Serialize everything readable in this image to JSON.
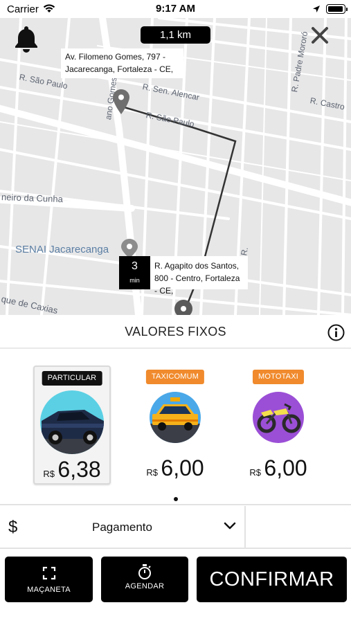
{
  "status_bar": {
    "carrier": "Carrier",
    "time": "9:17 AM"
  },
  "map": {
    "distance": "1,1 km",
    "origin_address": "Av. Filomeno Gomes, 797 - Jacarecanga, Fortaleza - CE,",
    "destination_address": "R. Agapito dos Santos, 800 - Centro, Fortaleza - CE,",
    "eta_value": "3",
    "eta_unit": "min",
    "poi": "SENAI Jacarecanga",
    "streets": {
      "sao_paulo_left": "R. São Paulo",
      "sao_paulo_route": "R. São Paulo",
      "sen_alencar": "R. Sen. Alencar",
      "padre_mororo": "R. Padre Mororó",
      "castro": "R. Castro",
      "gomes": "ano Gomes",
      "cunha": "neiro da Cunha",
      "caxias": "que de Caxias",
      "small_r": "R."
    }
  },
  "fixed_values": {
    "title": "VALORES FIXOS"
  },
  "options": [
    {
      "badge": "PARTICULAR",
      "badge_color": "#111111",
      "currency": "R$",
      "price": "6,38",
      "icon": "car-icon",
      "selected": true
    },
    {
      "badge": "TAXICOMUM",
      "badge_color": "#f08a2c",
      "currency": "R$",
      "price": "6,00",
      "icon": "taxi-icon",
      "selected": false
    },
    {
      "badge": "MOTOTAXI",
      "badge_color": "#f08a2c",
      "currency": "R$",
      "price": "6,00",
      "icon": "motorcycle-icon",
      "selected": false
    }
  ],
  "payment": {
    "icon_symbol": "$",
    "label": "Pagamento"
  },
  "buttons": {
    "handle": "MAÇANETA",
    "schedule": "AGENDAR",
    "confirm": "CONFIRMAR"
  },
  "colors": {
    "accent": "#f08a2c",
    "dark": "#000000",
    "map_bg": "#e7e7e8",
    "route": "#333333"
  }
}
